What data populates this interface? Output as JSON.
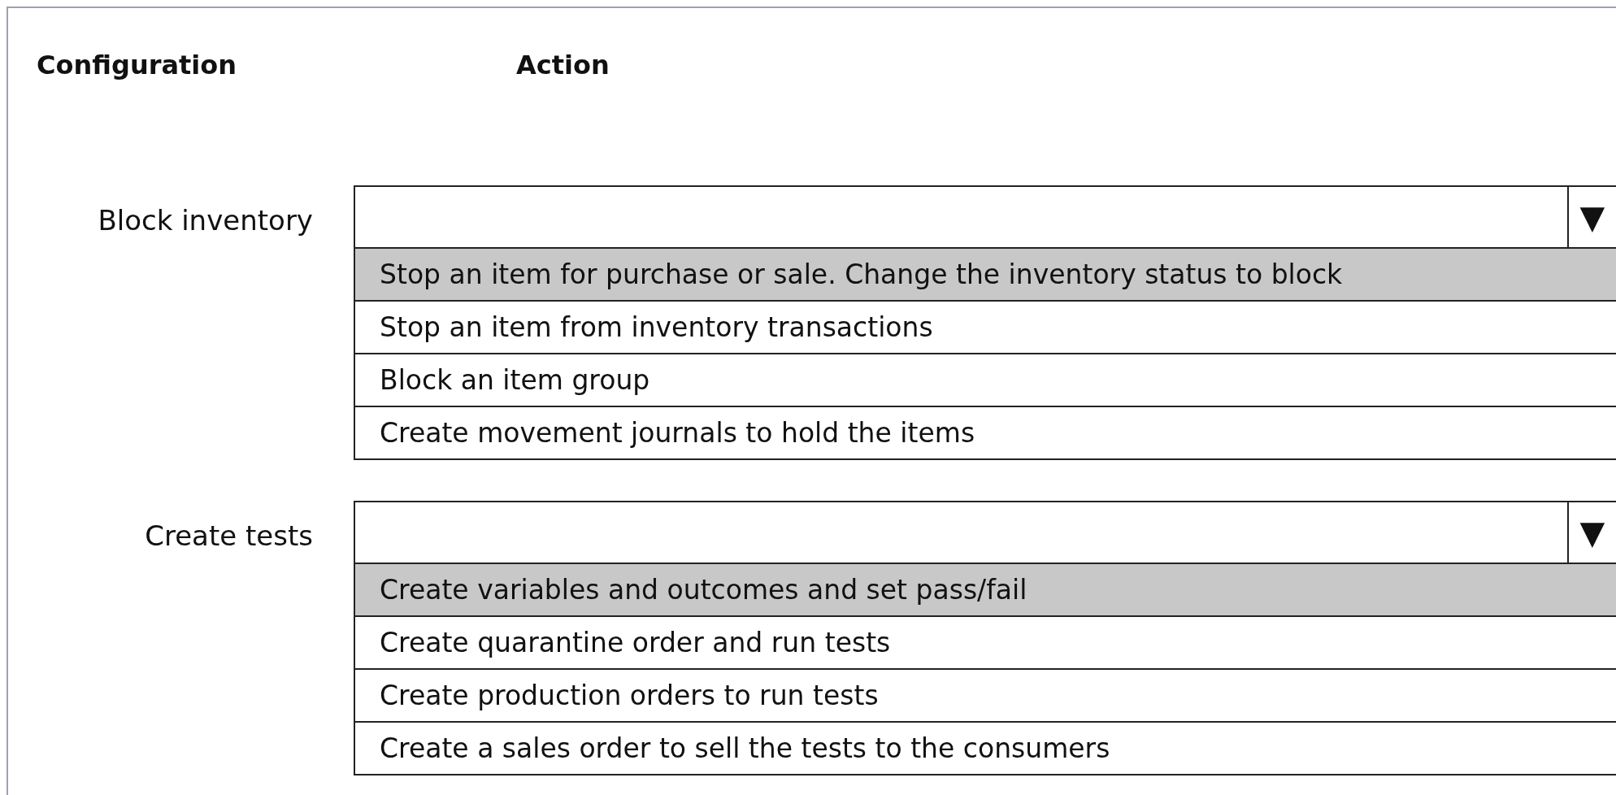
{
  "header": {
    "configuration": "Configuration",
    "action": "Action"
  },
  "sections": [
    {
      "label": "Block inventory",
      "dropdown": {
        "arrow": "▼"
      },
      "options": [
        {
          "text": "Stop an item for purchase or sale. Change the inventory status to block",
          "selected": true
        },
        {
          "text": "Stop an item from inventory transactions",
          "selected": false
        },
        {
          "text": "Block an item group",
          "selected": false
        },
        {
          "text": "Create movement journals to hold the items",
          "selected": false
        }
      ]
    },
    {
      "label": "Create tests",
      "dropdown": {
        "arrow": "▼"
      },
      "options": [
        {
          "text": "Create variables and outcomes and set pass/fail",
          "selected": true
        },
        {
          "text": "Create quarantine order and run tests",
          "selected": false
        },
        {
          "text": "Create production orders to run tests",
          "selected": false
        },
        {
          "text": "Create a sales order to sell the tests to the consumers",
          "selected": false
        }
      ]
    }
  ]
}
